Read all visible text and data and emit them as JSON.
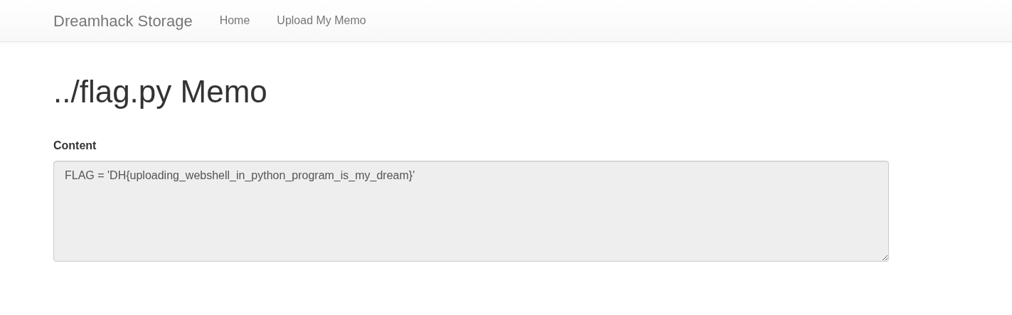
{
  "navbar": {
    "brand": "Dreamhack Storage",
    "links": [
      {
        "label": "Home"
      },
      {
        "label": "Upload My Memo"
      }
    ]
  },
  "heading": "../flag.py Memo",
  "content_field": {
    "label": "Content",
    "value": "FLAG = 'DH{uploading_webshell_in_python_program_is_my_dream}'",
    "readonly": true
  }
}
